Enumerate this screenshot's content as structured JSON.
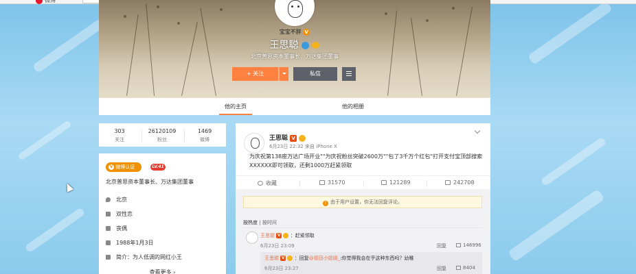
{
  "browser": {
    "logo_text": "微博"
  },
  "cover": {
    "avatar_label": "宝宝不胖",
    "name": "王思聪",
    "description": "北京普思资本董事长、万达集团董事",
    "follow_label": "+ 关注",
    "message_label": "私信"
  },
  "tabs": [
    {
      "label": "他的主页",
      "active": true
    },
    {
      "label": "他的相册",
      "active": false
    }
  ],
  "stats": [
    {
      "num": "303",
      "label": "关注"
    },
    {
      "num": "26120109",
      "label": "粉丝"
    },
    {
      "num": "1469",
      "label": "微博"
    }
  ],
  "profile": {
    "verify_label": "微博认证",
    "level": "LV.41",
    "intro": "北京普思资本董事长、万达集团董事",
    "rows": [
      {
        "icon": "location-icon",
        "text": "北京"
      },
      {
        "icon": "heart-icon",
        "text": "双性恋"
      },
      {
        "icon": "relationship-icon",
        "text": "丧偶"
      },
      {
        "icon": "birthday-icon",
        "text": "1988年1月3日"
      },
      {
        "icon": "intro-icon",
        "text": "简介：为人低调的网红小王"
      }
    ],
    "more_label": "查看更多 ›"
  },
  "post": {
    "author": "王思聪",
    "time": "6月23日 22:32 来自 iPhone X",
    "text": "为庆祝第138座万达广场开业\"\"为庆祝粉丝突破2600万\"\"包了3千万个红包\"打开支付宝顶部搜索XXXXXX即可领取，还剩1000万赶紧领取",
    "actions": {
      "favorite": "收藏",
      "repost": "31570",
      "comment": "121289",
      "like": "242708"
    }
  },
  "comments": {
    "notice": "由于用户设置，你无法回复评论。",
    "sort_hot": "按热度",
    "sort_sep": "|",
    "sort_time": "按时间",
    "items": [
      {
        "user": "王思聪",
        "text": "：赶紧领取",
        "time": "6月23日 23:09",
        "reply": "回复",
        "likes": "146996"
      }
    ],
    "sub": {
      "user": "王思聪",
      "prefix": "：回复",
      "mention": "@德田小姐姐_",
      "text": ":你觉得我会在乎这种东西吗？幼稚",
      "time": "6月23日 23:27",
      "reply": "回复",
      "likes": "8404"
    }
  },
  "colors": {
    "accent": "#ff8140",
    "verify": "#f29100",
    "link": "#eb7350",
    "dark_button": "#5e6169"
  }
}
